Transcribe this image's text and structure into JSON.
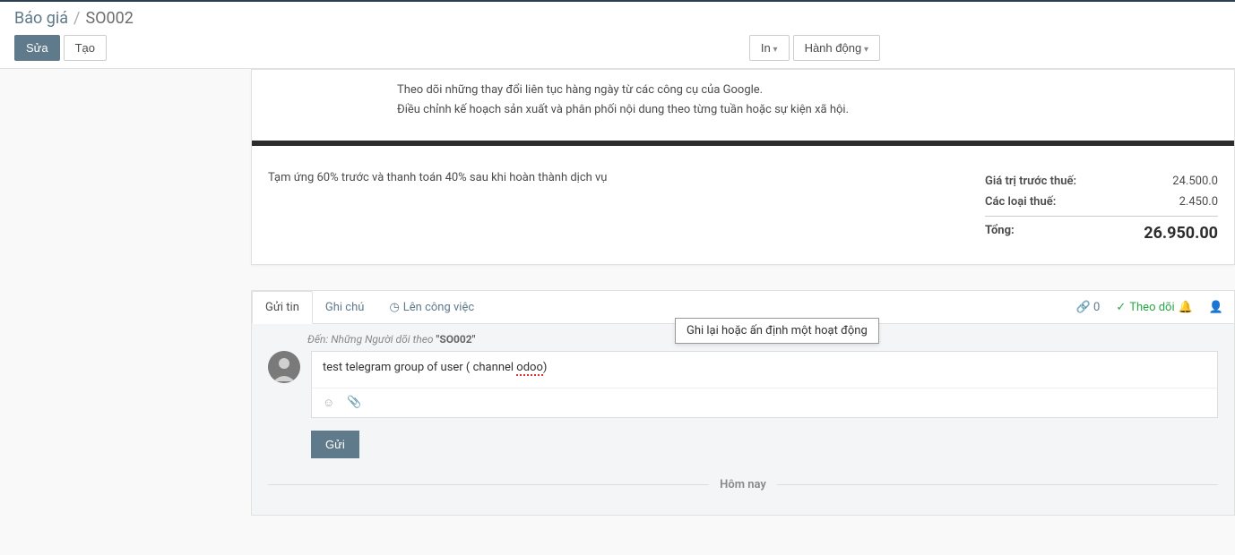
{
  "breadcrumb": {
    "root": "Báo giá",
    "sep": "/",
    "current": "SO002"
  },
  "header": {
    "edit_btn": "Sửa",
    "create_btn": "Tạo",
    "print_btn": "In",
    "action_btn": "Hành động"
  },
  "description": {
    "line1": "Theo dõi những thay đổi liên tục hàng ngày từ các công cụ của Google.",
    "line2": "Điều chỉnh kế hoạch sản xuất và phân phối nội dung theo từng tuần hoặc sự kiện xã hội."
  },
  "payment_terms": "Tạm ứng 60% trước và thanh toán 40% sau khi hoàn thành dịch vụ",
  "totals": {
    "subtotal_label": "Giá trị trước thuế:",
    "subtotal_value": "24.500.0",
    "tax_label": "Các loại thuế:",
    "tax_value": "2.450.0",
    "total_label": "Tổng:",
    "total_value": "26.950.00"
  },
  "chatter": {
    "tabs": {
      "send": "Gửi tin",
      "note": "Ghi chú",
      "activity": "Lên công việc"
    },
    "tooltip": "Ghi lại hoặc ấn định một hoạt động",
    "attach_count": "0",
    "follow_label": "Theo dõi",
    "recipients_label": "Đến:",
    "recipients_text": "Những Người dõi theo",
    "recipients_doc": "\"SO002\"",
    "message_prefix": "test telegram group of user ( channel ",
    "message_misspell": "odoo",
    "message_suffix": ")",
    "send_btn": "Gửi",
    "day_label": "Hôm nay"
  }
}
